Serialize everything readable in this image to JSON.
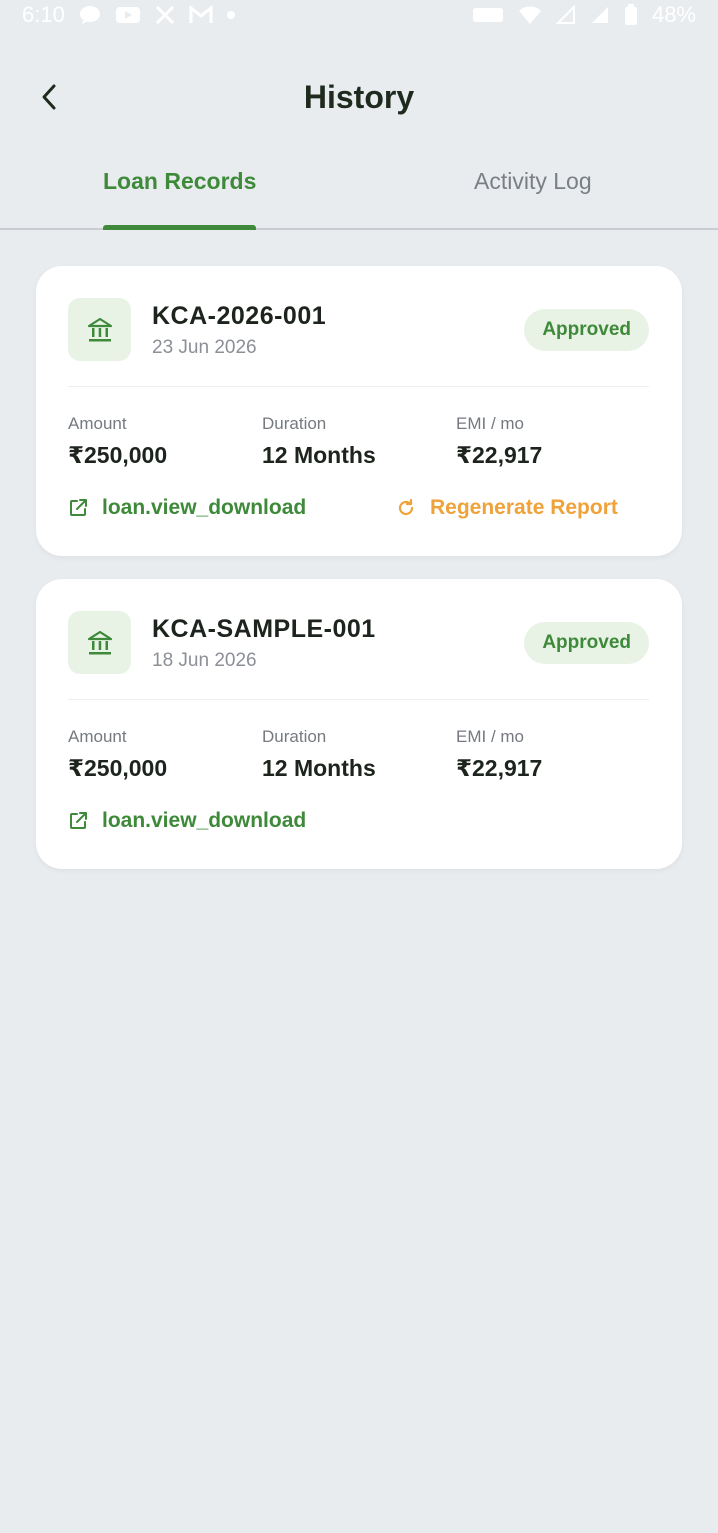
{
  "status_bar": {
    "time": "6:10",
    "battery": "48%"
  },
  "header": {
    "title": "History"
  },
  "tabs": [
    {
      "label": "Loan Records",
      "active": true
    },
    {
      "label": "Activity Log",
      "active": false
    }
  ],
  "colors": {
    "accent": "#3e8a3a",
    "warning": "#f0a23a",
    "badge_bg": "#e8f3e6",
    "background": "#e9ecef"
  },
  "labels": {
    "amount": "Amount",
    "duration": "Duration",
    "emi": "EMI / mo"
  },
  "records": [
    {
      "id": "KCA-2026-001",
      "date": "23 Jun 2026",
      "status": "Approved",
      "amount": "₹250,000",
      "duration": "12 Months",
      "emi": "₹22,917",
      "download_label": "loan.view_download",
      "regenerate_label": "Regenerate Report"
    },
    {
      "id": "KCA-SAMPLE-001",
      "date": "18 Jun 2026",
      "status": "Approved",
      "amount": "₹250,000",
      "duration": "12 Months",
      "emi": "₹22,917",
      "download_label": "loan.view_download"
    }
  ]
}
